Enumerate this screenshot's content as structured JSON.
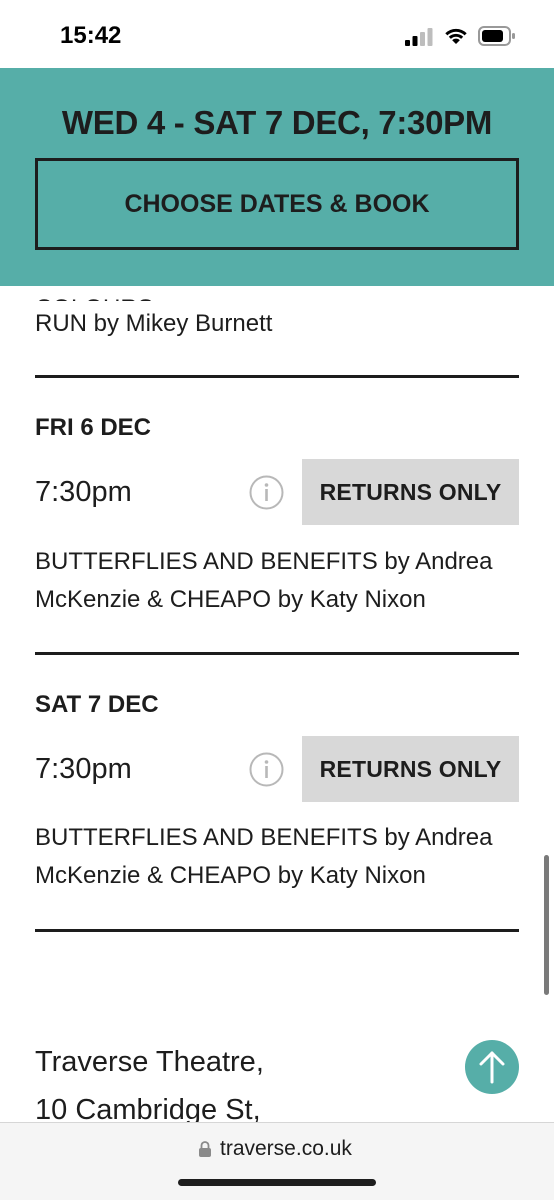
{
  "status_bar": {
    "time": "15:42"
  },
  "banner": {
    "title": "WED 4 - SAT 7 DEC, 7:30PM",
    "book_label": "CHOOSE DATES & BOOK"
  },
  "performances": {
    "prev_desc_cut": "FUCKERS by Ruaraidh Murray & COLOURS",
    "prev_desc_end": "RUN by Mikey Burnett",
    "items": [
      {
        "day": "FRI 6 DEC",
        "time": "7:30pm",
        "button": "RETURNS ONLY",
        "desc_line1": "BUTTERFLIES AND BENEFITS by Andrea",
        "desc_line2": "McKenzie & CHEAPO by Katy Nixon"
      },
      {
        "day": "SAT 7 DEC",
        "time": "7:30pm",
        "button": "RETURNS ONLY",
        "desc_line1": "BUTTERFLIES AND BENEFITS by Andrea",
        "desc_line2": "McKenzie & CHEAPO by Katy Nixon"
      }
    ]
  },
  "footer": {
    "venue_line1": "Traverse Theatre,",
    "venue_line2": "10 Cambridge St,"
  },
  "url_bar": {
    "url": "traverse.co.uk"
  },
  "colors": {
    "accent": "#56aea8",
    "returns_bg": "#d8d8d8",
    "text": "#1d1d1d"
  },
  "icons": {
    "info": "info-circle-icon",
    "back_to_top": "arrow-up-icon",
    "lock": "lock-icon"
  }
}
